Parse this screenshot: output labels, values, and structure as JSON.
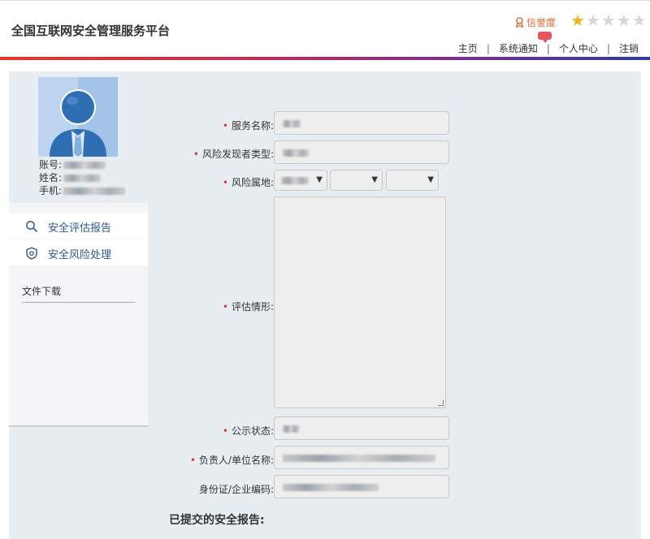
{
  "header": {
    "title": "全国互联网安全管理服务平台",
    "credit_label": "信誉度",
    "star_rating": 1,
    "star_max": 5,
    "nav": [
      "主页",
      "系统通知",
      "个人中心",
      "注销"
    ],
    "nav_sep": "|"
  },
  "profile": {
    "account_label": "账号:",
    "name_label": "姓名:",
    "phone_label": "手机:"
  },
  "sidebar": {
    "items": [
      {
        "label": "安全评估报告",
        "icon": "search-icon"
      },
      {
        "label": "安全风险处理",
        "icon": "shield-icon"
      }
    ],
    "download_label": "文件下载"
  },
  "form": {
    "service_name_label": "服务名称:",
    "risk_discoverer_type_label": "风险发现者类型:",
    "risk_location_label": "风险属地:",
    "assessment_label": "评估情形:",
    "public_status_label": "公示状态:",
    "responsible_label": "负责人/单位名称:",
    "id_label": "身份证/企业编码:"
  },
  "submitted_reports_title": "已提交的安全报告:",
  "colors": {
    "accent_red": "#e23a2b",
    "accent_blue": "#2c3c9e",
    "credit_orange": "#e8652d",
    "star_gold": "#f2b41c",
    "menu_text": "#2e5a8c"
  }
}
